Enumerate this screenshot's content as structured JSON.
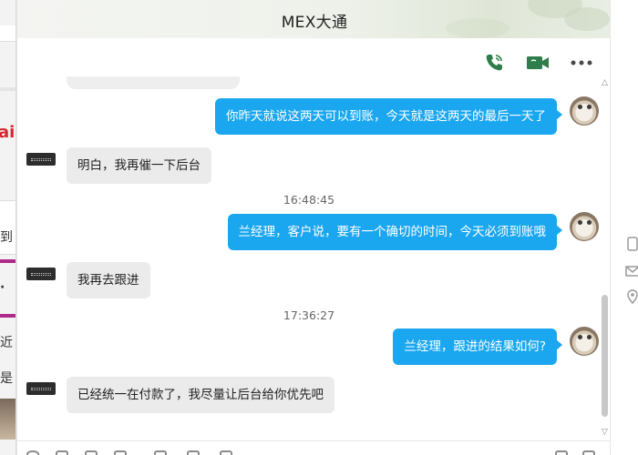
{
  "window": {
    "title": "MEX大通"
  },
  "toolbar": {
    "icons": [
      "phone-icon",
      "video-call-icon",
      "more-icon"
    ]
  },
  "background_left": {
    "logo_text": "ai",
    "snippets": [
      "到",
      "·",
      "近",
      "是"
    ]
  },
  "messages": [
    {
      "type": "out",
      "text": "你昨天就说这两天可以到账，今天就是这两天的最后一天了"
    },
    {
      "type": "in",
      "text": "明白，我再催一下后台"
    },
    {
      "type": "time",
      "text": "16:48:45"
    },
    {
      "type": "out",
      "text": "兰经理，客户说，要有一个确切的时间，今天必须到账哦"
    },
    {
      "type": "in",
      "text": "我再去跟进"
    },
    {
      "type": "time",
      "text": "17:36:27"
    },
    {
      "type": "out",
      "text": "兰经理，跟进的结果如何?"
    },
    {
      "type": "in",
      "text": "已经统一在付款了，我尽量让后台给你优先吧"
    }
  ],
  "colors": {
    "outgoing_bubble": "#1aa7ef",
    "incoming_bubble": "#ebebeb",
    "icon_green": "#2f7d4a"
  }
}
